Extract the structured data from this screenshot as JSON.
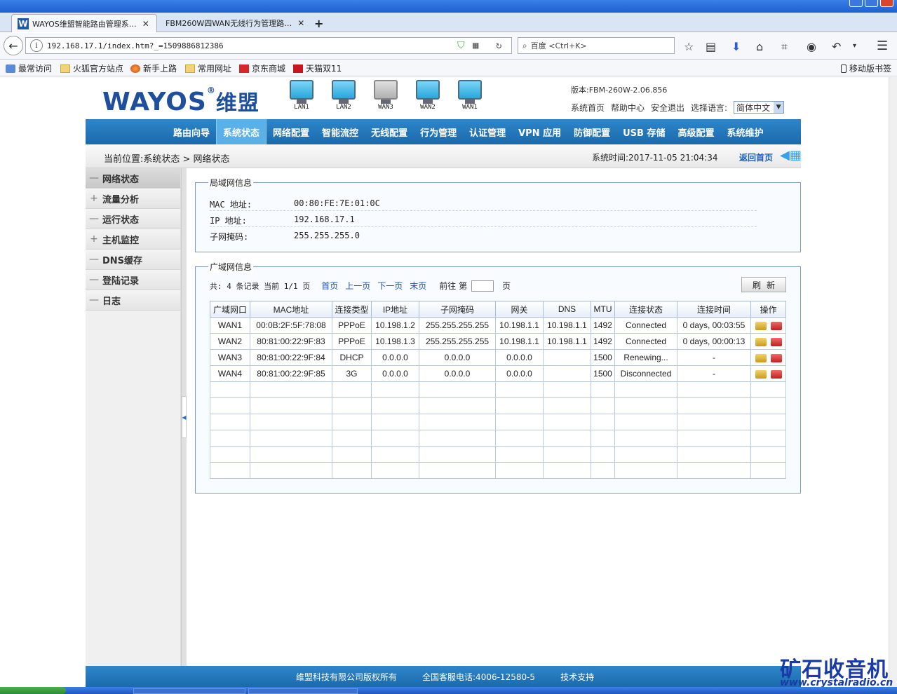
{
  "browser": {
    "tabs": [
      {
        "label": "WAYOS维盟智能路由管理系…",
        "active": true
      },
      {
        "label": "FBM260W四WAN无线行为管理路…",
        "active": false
      }
    ],
    "new_tab_symbol": "+",
    "url": "192.168.17.1/index.htm?_=1509886812386",
    "search_placeholder": "百度 <Ctrl+K>",
    "bookmarks": [
      "最常访问",
      "火狐官方站点",
      "新手上路",
      "常用网址",
      "京东商城",
      "天猫双11"
    ],
    "mobile_bookmarks": "移动版书签"
  },
  "header": {
    "logo_text": "WAYOS",
    "logo_cn": "维盟",
    "ports": [
      {
        "label": "LAN1",
        "active": true
      },
      {
        "label": "LAN2",
        "active": true
      },
      {
        "label": "WAN3",
        "active": false
      },
      {
        "label": "WAN2",
        "active": true
      },
      {
        "label": "WAN1",
        "active": true
      }
    ],
    "version": "版本:FBM-260W-2.06.856",
    "links": [
      "系统首页",
      "帮助中心",
      "安全退出"
    ],
    "lang_label": "选择语言:",
    "lang_value": "简体中文"
  },
  "nav": {
    "items": [
      "路由向导",
      "系统状态",
      "网络配置",
      "智能流控",
      "无线配置",
      "行为管理",
      "认证管理",
      "VPN 应用",
      "防御配置",
      "USB 存储",
      "高级配置",
      "系统维护"
    ],
    "active_index": 1
  },
  "crumb": {
    "text": "当前位置:系统状态 > 网络状态",
    "systime": "系统时间:2017-11-05 21:04:34",
    "back_home": "返回首页"
  },
  "sidebar": {
    "items": [
      {
        "label": "网络状态",
        "sign": "—",
        "active": true
      },
      {
        "label": "流量分析",
        "sign": "+",
        "active": false
      },
      {
        "label": "运行状态",
        "sign": "—",
        "active": false
      },
      {
        "label": "主机监控",
        "sign": "+",
        "active": false
      },
      {
        "label": "DNS缓存",
        "sign": "—",
        "active": false
      },
      {
        "label": "登陆记录",
        "sign": "—",
        "active": false
      },
      {
        "label": "日志",
        "sign": "—",
        "active": false
      }
    ]
  },
  "lan": {
    "legend": "局域网信息",
    "rows": [
      {
        "k": "MAC 地址:",
        "v": "00:80:FE:7E:01:0C"
      },
      {
        "k": "IP 地址:",
        "v": "192.168.17.1"
      },
      {
        "k": "子网掩码:",
        "v": "255.255.255.0"
      }
    ]
  },
  "wan": {
    "legend": "广域网信息",
    "pager": {
      "summary": "共: 4 条记录 当前 1/1 页",
      "first": "首页",
      "prev": "上一页",
      "next": "下一页",
      "last": "末页",
      "goto_pre": "前往 第",
      "goto_post": "页"
    },
    "refresh": "刷新",
    "columns": [
      "广域网口",
      "MAC地址",
      "连接类型",
      "IP地址",
      "子网掩码",
      "网关",
      "DNS",
      "MTU",
      "连接状态",
      "连接时间",
      "操作"
    ],
    "rows": [
      [
        "WAN1",
        "00:0B:2F:5F:78:08",
        "PPPoE",
        "10.198.1.2",
        "255.255.255.255",
        "10.198.1.1",
        "10.198.1.1",
        "1492",
        "Connected",
        "0 days, 00:03:55"
      ],
      [
        "WAN2",
        "80:81:00:22:9F:83",
        "PPPoE",
        "10.198.1.3",
        "255.255.255.255",
        "10.198.1.1",
        "10.198.1.1",
        "1492",
        "Connected",
        "0 days, 00:00:13"
      ],
      [
        "WAN3",
        "80:81:00:22:9F:84",
        "DHCP",
        "0.0.0.0",
        "0.0.0.0",
        "0.0.0.0",
        "",
        "1500",
        "Renewing...",
        "-"
      ],
      [
        "WAN4",
        "80:81:00:22:9F:85",
        "3G",
        "0.0.0.0",
        "0.0.0.0",
        "0.0.0.0",
        "",
        "1500",
        "Disconnected",
        "-"
      ]
    ],
    "empty_rows": 6
  },
  "footer": {
    "items": [
      "维盟科技有限公司版权所有",
      "全国客服电话:4006-12580-5",
      "技术支持"
    ]
  },
  "watermark": {
    "line1": "矿石收音机",
    "line2": "www.crystalradio.cn"
  }
}
